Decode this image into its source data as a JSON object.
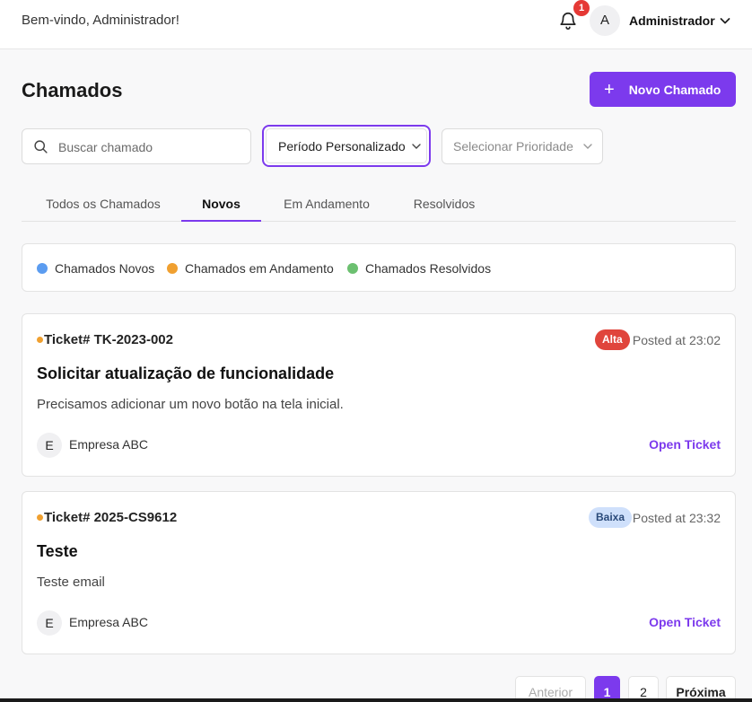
{
  "header": {
    "welcome": "Bem-vindo, Administrador!",
    "notification_count": "1",
    "avatar_initial": "A",
    "user_name": "Administrador"
  },
  "page": {
    "title": "Chamados",
    "new_button_label": "Novo Chamado",
    "new_button_icon": "+"
  },
  "filters": {
    "search_placeholder": "Buscar chamado",
    "period_label": "Período Personalizado",
    "priority_placeholder": "Selecionar Prioridade"
  },
  "tabs": [
    {
      "label": "Todos os Chamados"
    },
    {
      "label": "Novos"
    },
    {
      "label": "Em Andamento"
    },
    {
      "label": "Resolvidos"
    }
  ],
  "legend": [
    {
      "label": "Chamados Novos",
      "color": "#5b9cf0"
    },
    {
      "label": "Chamados em Andamento",
      "color": "#f0a030"
    },
    {
      "label": "Chamados Resolvidos",
      "color": "#6cc070"
    }
  ],
  "tickets": [
    {
      "id": "Ticket# TK-2023-002",
      "priority": "Alta",
      "priority_bg": "#e0453c",
      "priority_fg": "#ffffff",
      "posted": "Posted at 23:02",
      "title": "Solicitar atualização de funcionalidade",
      "description": "Precisamos adicionar um novo botão na tela inicial.",
      "company_initial": "E",
      "company": "Empresa ABC",
      "action": "Open Ticket"
    },
    {
      "id": "Ticket# 2025-CS9612",
      "priority": "Baixa",
      "priority_bg": "#cfe0fb",
      "priority_fg": "#2a4a7a",
      "posted": "Posted at 23:32",
      "title": "Teste",
      "description": "Teste email",
      "company_initial": "E",
      "company": "Empresa ABC",
      "action": "Open Ticket"
    }
  ],
  "pagination": {
    "prev": "Anterior",
    "pages": [
      "1",
      "2"
    ],
    "current_page": "1",
    "next": "Próxima"
  },
  "colors": {
    "accent": "#7c3aed"
  }
}
